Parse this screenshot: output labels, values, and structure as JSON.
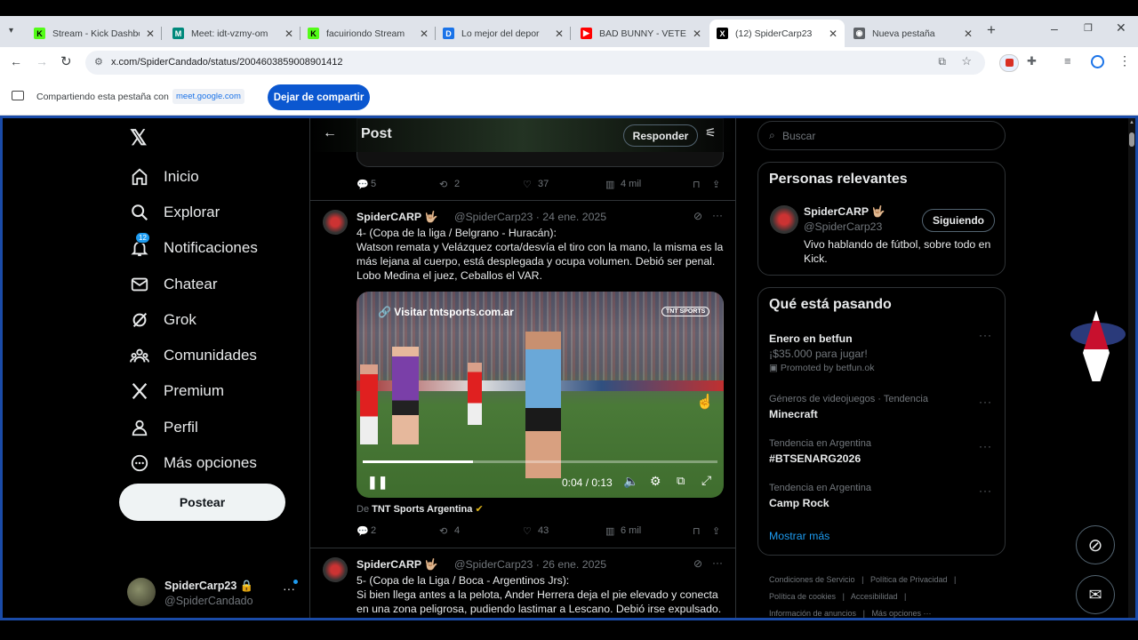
{
  "browser": {
    "tabs": [
      {
        "title": "Stream - Kick Dashboa",
        "fav": "K",
        "color": "#53fc18",
        "fg": "#000"
      },
      {
        "title": "Meet: idt-vzmy-om",
        "fav": "M",
        "color": "#00897b",
        "fg": "#fff"
      },
      {
        "title": "facuiriondo Stream",
        "fav": "K",
        "color": "#53fc18",
        "fg": "#000"
      },
      {
        "title": "Lo mejor del depor",
        "fav": "D",
        "color": "#1a73e8",
        "fg": "#fff"
      },
      {
        "title": "BAD BUNNY - VETE | V",
        "fav": "▶",
        "color": "#ff0000",
        "fg": "#fff"
      },
      {
        "title": "(12) SpiderCarp23",
        "fav": "X",
        "color": "#000",
        "fg": "#fff"
      },
      {
        "title": "Nueva pestaña",
        "fav": "◉",
        "color": "#5f6368",
        "fg": "#fff"
      }
    ],
    "url": "x.com/SpiderCandado/status/2004603859008901412",
    "share_text": "Compartiendo esta pestaña con",
    "share_target": "meet.google.com",
    "stop_button": "Dejar de compartir"
  },
  "sidebar": {
    "items": [
      {
        "label": "Inicio",
        "icon": "home-icon"
      },
      {
        "label": "Explorar",
        "icon": "search-icon"
      },
      {
        "label": "Notificaciones",
        "icon": "bell-icon",
        "badge": "12"
      },
      {
        "label": "Chatear",
        "icon": "mail-icon"
      },
      {
        "label": "Grok",
        "icon": "grok-icon"
      },
      {
        "label": "Comunidades",
        "icon": "communities-icon"
      },
      {
        "label": "Premium",
        "icon": "x-icon"
      },
      {
        "label": "Perfil",
        "icon": "person-icon"
      },
      {
        "label": "Más opciones",
        "icon": "more-circle-icon"
      }
    ],
    "post_button": "Postear",
    "account": {
      "name": "SpiderCarp23 🔒",
      "handle": "@SpiderCandado"
    }
  },
  "header": {
    "title": "Post",
    "reply_button": "Responder"
  },
  "top_actions": {
    "replies": "5",
    "reposts": "2",
    "likes": "37",
    "views": "4 mil"
  },
  "tweet1": {
    "name": "SpiderCARP 🤟🏼",
    "meta": "@SpiderCarp23 · 24 ene. 2025",
    "text": "4- (Copa de la liga / Belgrano - Huracán):\nWatson remata y Velázquez corta/desvía el tiro con la mano, la misma es la más lejana al cuerpo, está desplegada y ocupa volumen. Debió ser penal. Lobo Medina el juez, Ceballos el VAR.",
    "video_link": "Visitar tntsports.com.ar",
    "video_brand": "TNT SPORTS",
    "time": "0:04 / 0:13",
    "progress": 0.31,
    "source_prefix": "De",
    "source": "TNT Sports Argentina",
    "replies": "2",
    "reposts": "4",
    "likes": "43",
    "views": "6 mil"
  },
  "tweet2": {
    "name": "SpiderCARP 🤟🏼",
    "meta": "@SpiderCarp23 · 26 ene. 2025",
    "text": "5- (Copa de la Liga / Boca - Argentinos Jrs):\nSi bien llega antes a la pelota, Ander Herrera deja el pie elevado y conecta en una zona peligrosa, pudiendo lastimar a Lescano. Debió irse expulsado. Mastrangelo el juez. Carreras el VAR."
  },
  "right": {
    "search_placeholder": "Buscar",
    "relevant_title": "Personas relevantes",
    "relevant": {
      "name": "SpiderCARP 🤟🏼",
      "handle": "@SpiderCarp23",
      "follow": "Siguiendo",
      "bio": "Vivo hablando de fútbol, sobre todo en Kick."
    },
    "trends_title": "Qué está pasando",
    "trends": [
      {
        "context": "",
        "title": "Enero en betfun",
        "sub": "¡$35.000 para jugar!",
        "promo": "Promoted by betfun.ok"
      },
      {
        "context": "Géneros de videojuegos · Tendencia",
        "title": "Minecraft"
      },
      {
        "context": "Tendencia en Argentina",
        "title": "#BTSENARG2026"
      },
      {
        "context": "Tendencia en Argentina",
        "title": "Camp Rock"
      }
    ],
    "show_more": "Mostrar más",
    "footer": [
      "Condiciones de Servicio",
      "Política de Privacidad",
      "Política de cookies",
      "Accesibilidad",
      "Información de anuncios",
      "Más opciones ···"
    ]
  }
}
